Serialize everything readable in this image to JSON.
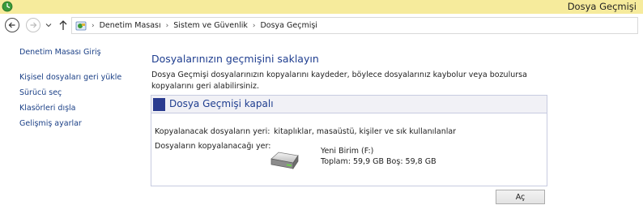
{
  "window": {
    "title": "Dosya Geçmişi"
  },
  "address_bar": {
    "breadcrumbs": [
      "Denetim Masası",
      "Sistem ve Güvenlik",
      "Dosya Geçmişi"
    ]
  },
  "sidebar": {
    "items": [
      {
        "label": "Denetim Masası Giriş"
      },
      {
        "label": "Kişisel dosyaları geri yükle"
      },
      {
        "label": "Sürücü seç"
      },
      {
        "label": "Klasörleri dışla"
      },
      {
        "label": "Gelişmiş ayarlar"
      }
    ]
  },
  "main": {
    "title": "Dosyalarınızın geçmişini saklayın",
    "description": "Dosya Geçmişi dosyalarınızın kopyalarını kaydeder, böylece dosyalarınız kaybolur veya bozulursa kopyalarını geri alabilirsiniz.",
    "status_panel": {
      "title": "Dosya Geçmişi kapalı",
      "copy_source_label": "Kopyalanacak dosyaların yeri:",
      "copy_source_value": "kitaplıklar, masaüstü, kişiler ve sık kullanılanlar",
      "copy_target_label": "Dosyaların kopyalanacağı yer:",
      "drive_name": "Yeni Birim (F:)",
      "drive_space": "Toplam: 59,9 GB Boş: 59,8 GB"
    },
    "open_button": "Aç"
  },
  "colors": {
    "title_bar": "#f6eb9c",
    "link": "#1a3f86",
    "heading": "#1e3d8f",
    "panel_accent": "#2a3b8f"
  }
}
